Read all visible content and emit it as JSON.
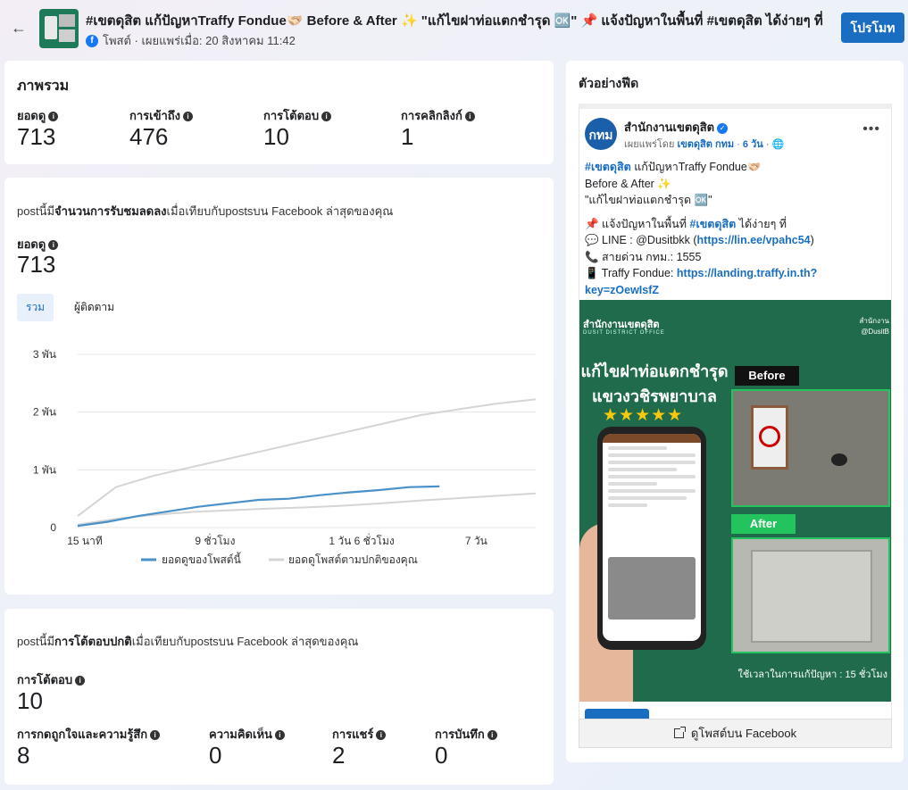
{
  "header": {
    "back_icon": "arrow-left-icon",
    "post_title": "#เขตดุสิต แก้ปัญหาTraffy Fondue🫱🏻‍🫲🏼 Before & After ✨ \"แก้ไขฝาท่อแตกชำรุด 🆗\" 📌 แจ้งปัญหาในพื้นที่ #เขตดุสิต ได้ง่ายๆ ที่",
    "meta": "โพสต์ · เผยแพร่เมื่อ: 20 สิงหาคม 11:42",
    "promote_label": "โปรโมท",
    "accent": "#1a6ec1"
  },
  "overview": {
    "title": "ภาพรวม",
    "metrics": [
      {
        "label": "ยอดดู",
        "value": "713"
      },
      {
        "label": "การเข้าถึง",
        "value": "476"
      },
      {
        "label": "การโต้ตอบ",
        "value": "10"
      },
      {
        "label": "การคลิกลิงก์",
        "value": "1"
      }
    ]
  },
  "views_section": {
    "sentence_pre": "postนี้มี",
    "sentence_bold": "จำนวนการรับชมลดลง",
    "sentence_post": "เมื่อเทียบกับpostsบน Facebook ล่าสุดของคุณ",
    "metric_label": "ยอดดู",
    "metric_value": "713",
    "tabs": [
      "รวม",
      "ผู้ติดตาม"
    ]
  },
  "chart_data": {
    "type": "line",
    "y_ticks": [
      "3 พัน",
      "2 พัน",
      "1 พัน",
      "0"
    ],
    "x_ticks": [
      "15 นาที",
      "9 ชั่วโมง",
      "1 วัน 6 ชั่วโมง",
      "7 วัน"
    ],
    "ylim": [
      0,
      3000
    ],
    "x": [
      0,
      1,
      2,
      3,
      4,
      5,
      6,
      7,
      8,
      9,
      10,
      11,
      12
    ],
    "series": [
      {
        "name": "ยอดดูของโพสต์นี้",
        "color": "#4a90c9",
        "values": [
          30,
          100,
          200,
          280,
          360,
          420,
          480,
          500,
          560,
          610,
          650,
          700,
          713
        ]
      },
      {
        "name": "ยอดดูโพสต์ตามปกติของคุณ",
        "color": "#d5d5d5",
        "values": [
          200,
          700,
          900,
          1050,
          1200,
          1350,
          1500,
          1650,
          1800,
          1950,
          2050,
          2150,
          2220
        ]
      },
      {
        "name": "ยอดดูโพสต์ตามปกติของคุณ-lower",
        "color": "#d5d5d5",
        "values": [
          50,
          150,
          220,
          270,
          300,
          330,
          350,
          380,
          420,
          470,
          510,
          550,
          590
        ]
      }
    ],
    "legend": [
      "ยอดดูของโพสต์นี้",
      "ยอดดูโพสต์ตามปกติของคุณ"
    ],
    "grid": true,
    "legend_position": "bottom"
  },
  "engagement": {
    "sentence_pre": "postนี้มี",
    "sentence_bold": "การโต้ตอบปกติ",
    "sentence_post": "เมื่อเทียบกับpostsบน Facebook ล่าสุดของคุณ",
    "metric_label": "การโต้ตอบ",
    "metric_value": "10",
    "metrics": [
      {
        "label": "การกดถูกใจและความรู้สึก",
        "value": "8"
      },
      {
        "label": "ความคิดเห็น",
        "value": "0"
      },
      {
        "label": "การแชร์",
        "value": "2"
      },
      {
        "label": "การบันทึก",
        "value": "0"
      }
    ]
  },
  "feed_preview": {
    "title": "ตัวอย่างฟีด",
    "page_name": "สำนักงานเขตดุสิต",
    "avatar_text": "กทม",
    "sub_pre": "เผยแพร่โดย",
    "sub_page": "เขตดุสิต กทม",
    "sub_time": "6 วัน",
    "line1_tag": "#เขตดุสิต",
    "line1_rest": " แก้ปัญหาTraffy Fondue🫱🏻‍🫲🏼",
    "line2": "Before & After ✨",
    "line3": "\"แก้ไขฝาท่อแตกชำรุด 🆗\"",
    "line4_pre": "📌 แจ้งปัญหาในพื้นที่ ",
    "line4_tag": "#เขตดุสิต",
    "line4_post": " ได้ง่ายๆ ที่",
    "line5_pre": "💬 LINE : @Dusitbkk (",
    "line5_link": "https://lin.ee/vpahc54",
    "line5_post": ")",
    "line6": "📞 สายด่วน กทม.: 1555",
    "line7_pre": "📱 Traffy Fondue: ",
    "line7_link": "https://landing.traffy.in.th?key=zOewIsfZ",
    "image": {
      "office": "สำนักงานเขตดุสิต",
      "office_sub": "DUSIT DISTRICT OFFICE",
      "right_top_1": "สำนักงาน",
      "right_top_2": "@DusitB",
      "headline_1": "แก้ไขฝาท่อแตกชำรุด",
      "headline_2": "แขวงวชิรพยาบาล",
      "stars": "★★★★★",
      "before": "Before",
      "after": "After",
      "caption": "ใช้เวลาในการแก้ปัญหา : 15 ชั่วโมง"
    },
    "view_on_fb": "ดูโพสต์บน Facebook"
  }
}
